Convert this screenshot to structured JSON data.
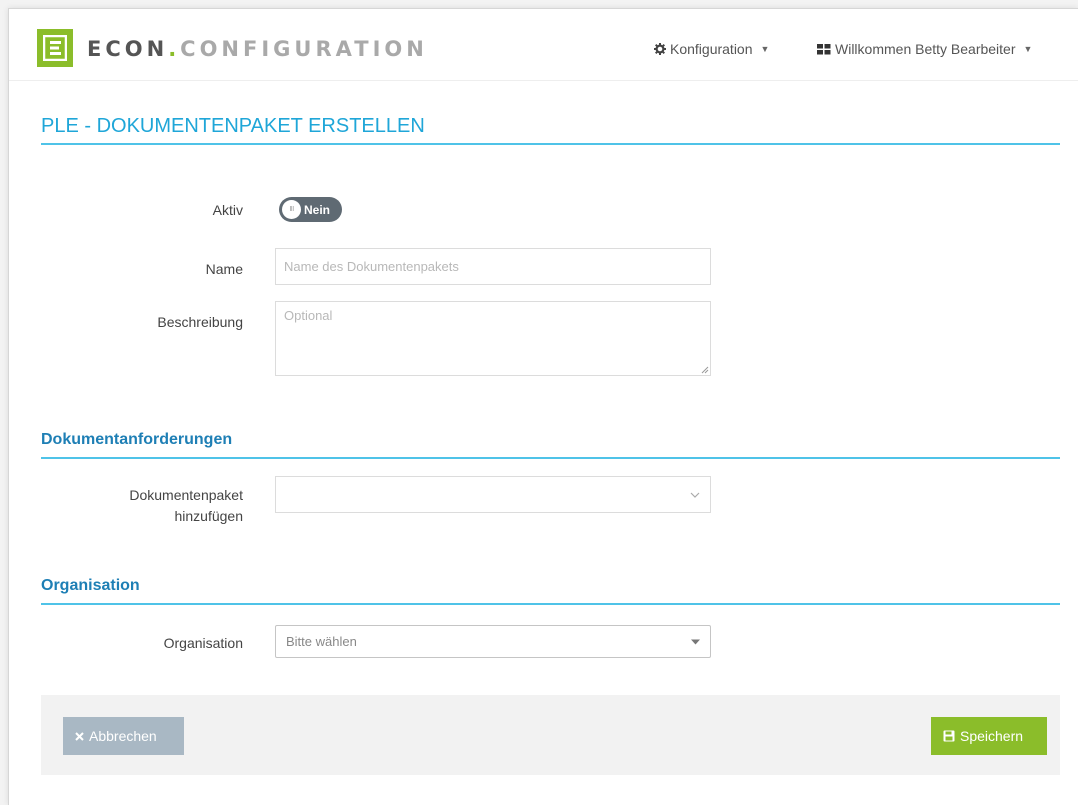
{
  "brand": {
    "name_main": "ECON",
    "name_dot": ".",
    "name_rest": "CONFIGURATION",
    "logo_letter": "E",
    "accent_color": "#8bbd2a"
  },
  "nav": {
    "config_label": "Konfiguration",
    "user_label": "Willkommen Betty Bearbeiter"
  },
  "page": {
    "title": "PLE - DOKUMENTENPAKET ERSTELLEN"
  },
  "form": {
    "aktiv_label": "Aktiv",
    "aktiv_toggle_text": "Nein",
    "aktiv_toggle_knob": "III",
    "name_label": "Name",
    "name_placeholder": "Name des Dokumentenpakets",
    "name_value": "",
    "beschreibung_label": "Beschreibung",
    "beschreibung_placeholder": "Optional",
    "beschreibung_value": ""
  },
  "dokumentanforderungen": {
    "title": "Dokumentanforderungen",
    "paket_label_line1": "Dokumentenpaket",
    "paket_label_line2": "hinzufügen",
    "paket_selected": ""
  },
  "organisation": {
    "title": "Organisation",
    "label": "Organisation",
    "selected": "Bitte wählen"
  },
  "footer": {
    "cancel_label": "Abbrechen",
    "save_label": "Speichern"
  }
}
